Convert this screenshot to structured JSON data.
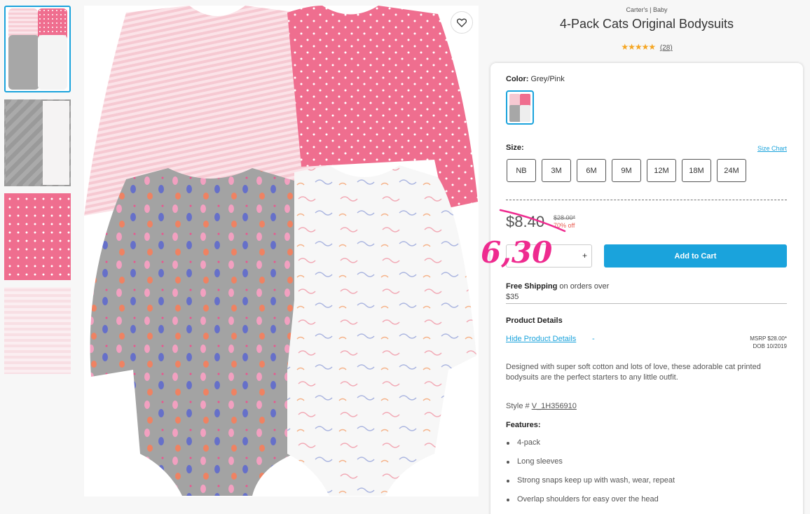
{
  "product": {
    "breadcrumb": "Carter's | Baby",
    "title": "4-Pack Cats Original Bodysuits",
    "stars": "★★★★★",
    "review_count": "(28)"
  },
  "color": {
    "label": "Color:",
    "value": "Grey/Pink"
  },
  "size": {
    "label": "Size:",
    "chart_link": "Size Chart",
    "options": [
      "NB",
      "3M",
      "6M",
      "9M",
      "12M",
      "18M",
      "24M"
    ]
  },
  "price": {
    "current": "$8.40",
    "original": "$28.00*",
    "discount": "70% off",
    "handwritten": "6,30"
  },
  "cart": {
    "plus": "+",
    "add_label": "Add to Cart"
  },
  "shipping": {
    "bold": "Free Shipping",
    "text": " on orders over",
    "amount": "$35"
  },
  "details": {
    "title": "Product Details",
    "toggle": "Hide Product Details",
    "toggle_icon": "-",
    "msrp": "MSRP $28.00*",
    "dob": "DOB 10/2019",
    "description": "Designed with super soft cotton and lots of love, these adorable cat printed bodysuits are the perfect starters to any little outfit.",
    "style_label": "Style # ",
    "style_num": "V_1H356910",
    "features_title": "Features:",
    "features": [
      "4-pack",
      "Long sleeves",
      "Strong snaps keep up with wash, wear, repeat",
      "Overlap shoulders for easy over the head"
    ]
  },
  "colors": {
    "accent": "#1aa3dc",
    "sale": "#e85a4f",
    "handwriting": "#ee2b8f",
    "pink": "#ef6e8f",
    "grey": "#a3a3a3"
  },
  "icons": {
    "favorite": "heart-outline-icon"
  }
}
